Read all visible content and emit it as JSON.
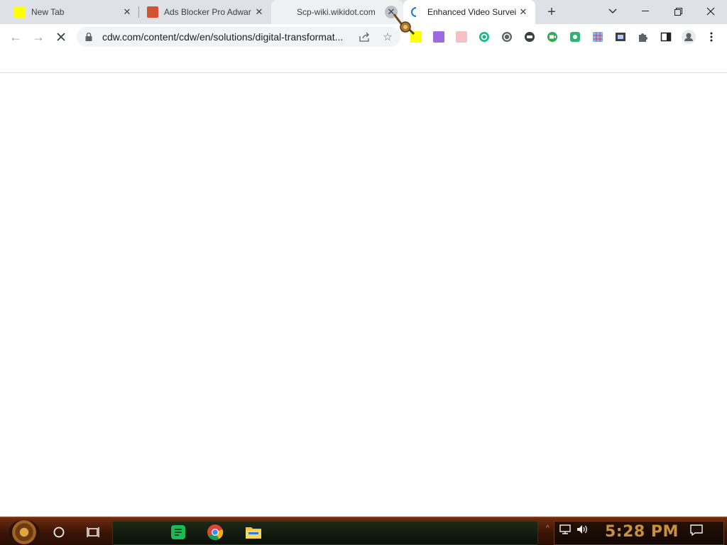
{
  "tabs": [
    {
      "title": "New Tab",
      "favicon_color": "#ffff00",
      "state": "inactive"
    },
    {
      "title": "Ads Blocker Pro Adwar",
      "favicon_color": "#d35230",
      "state": "inactive"
    },
    {
      "title": "Scp-wiki.wikidot.com",
      "favicon_color": "",
      "state": "hover"
    },
    {
      "title": "Enhanced Video Survei",
      "favicon_color": "#1a73e8",
      "state": "active-loading"
    }
  ],
  "omnibox": {
    "url": "cdw.com/content/cdw/en/solutions/digital-transformat..."
  },
  "extensions": [
    {
      "name": "yellow-square-extension-icon",
      "color": "#ffff00"
    },
    {
      "name": "purple-extension-icon",
      "color": "#9c6ade"
    },
    {
      "name": "pink-extension-icon",
      "color": "#f28b82"
    },
    {
      "name": "green-circle-extension-icon",
      "color": "#1db954"
    },
    {
      "name": "grey-circle-extension-icon",
      "color": "#5f6368"
    },
    {
      "name": "chat-bubble-extension-icon",
      "color": "#5f6368"
    },
    {
      "name": "green-video-extension-icon",
      "color": "#34a853"
    },
    {
      "name": "teal-extension-icon",
      "color": "#2bb673"
    },
    {
      "name": "blue-grid-extension-icon",
      "color": "#4285f4"
    },
    {
      "name": "film-extension-icon",
      "color": "#5f6368"
    }
  ],
  "taskbar": {
    "clock": "5:28 PM"
  },
  "colors": {
    "tab_strip": "#dee1e6",
    "omnibox_bg": "#f1f3f4",
    "clock_text": "#c8913a"
  }
}
